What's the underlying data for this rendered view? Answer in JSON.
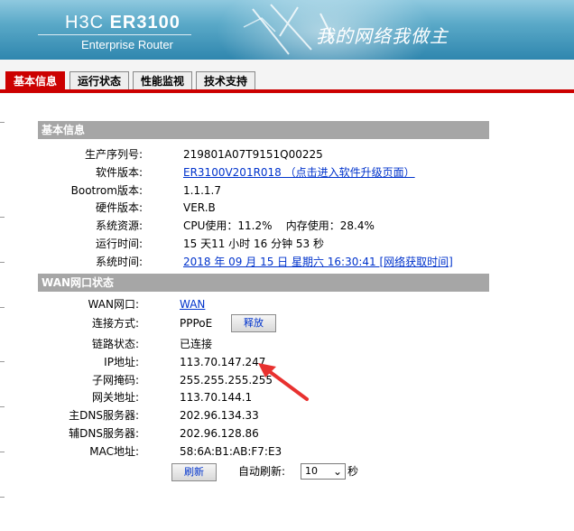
{
  "header": {
    "brand_prefix": "H3C",
    "brand_model": "ER3100",
    "subtitle": "Enterprise Router",
    "slogan": "我的网络我做主"
  },
  "tabs": [
    {
      "label": "基本信息",
      "active": true
    },
    {
      "label": "运行状态",
      "active": false
    },
    {
      "label": "性能监视",
      "active": false
    },
    {
      "label": "技术支持",
      "active": false
    }
  ],
  "basic": {
    "title": "基本信息",
    "rows": [
      {
        "label": "生产序列号:",
        "value": "219801A07T9151Q00225"
      },
      {
        "label": "软件版本:",
        "value": "ER3100V201R018 （点击进入软件升级页面）"
      },
      {
        "label": "Bootrom版本:",
        "value": "1.1.1.7"
      },
      {
        "label": "硬件版本:",
        "value": "VER.B"
      },
      {
        "label": "系统资源:",
        "value": "CPU使用：11.2%    内存使用：28.4%"
      },
      {
        "label": "运行时间:",
        "value": "15 天11 小时 16 分钟 53 秒"
      },
      {
        "label": "系统时间:",
        "value": "2018 年 09 月 15 日 星期六 16:30:41 [网络获取时间]"
      }
    ]
  },
  "wan": {
    "title": "WAN网口状态",
    "rows": [
      {
        "label": "WAN网口:",
        "value": "WAN"
      },
      {
        "label": "连接方式:",
        "value": "PPPoE"
      },
      {
        "label": "链路状态:",
        "value": "已连接"
      },
      {
        "label": "IP地址:",
        "value": "113.70.147.247"
      },
      {
        "label": "子网掩码:",
        "value": "255.255.255.255"
      },
      {
        "label": "网关地址:",
        "value": "113.70.144.1"
      },
      {
        "label": "主DNS服务器:",
        "value": "202.96.134.33"
      },
      {
        "label": "辅DNS服务器:",
        "value": "202.96.128.86"
      },
      {
        "label": "MAC地址:",
        "value": "58:6A:B1:AB:F7:E3"
      }
    ],
    "release_button": "释放"
  },
  "footer": {
    "refresh_button": "刷新",
    "auto_refresh_label": "自动刷新:",
    "auto_refresh_value": "10",
    "auto_refresh_unit": "秒"
  },
  "colors": {
    "accent": "#cc0000",
    "section_bg": "#a6a6a6",
    "link": "#0033cc"
  }
}
